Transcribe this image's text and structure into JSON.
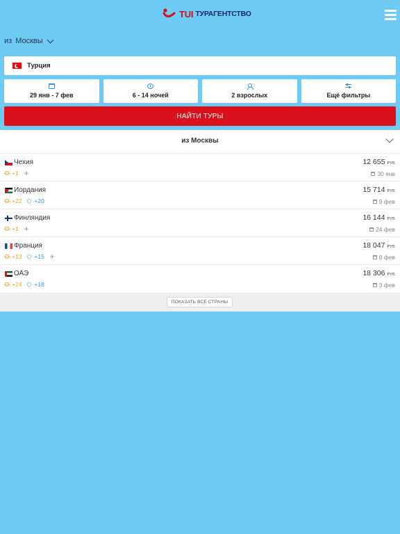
{
  "header": {
    "logo_brand": "TUI",
    "logo_text": "ТУРАГЕНТСТВО",
    "brand_color": "#d40e14",
    "menu_icon": "hamburger-menu-icon"
  },
  "search": {
    "from_prefix": "из",
    "from_city": "Москвы",
    "country": "Турция",
    "filters": [
      {
        "icon": "calendar-icon",
        "label": "29 янв - 7 фев"
      },
      {
        "icon": "clock-icon",
        "label": "6 - 14 ночей"
      },
      {
        "icon": "person-icon",
        "label": "2 взрослых"
      },
      {
        "icon": "sliders-icon",
        "label": "Ещё фильтры"
      }
    ],
    "submit_label": "НАЙТИ ТУРЫ",
    "submit_color": "#d9111d"
  },
  "offers": {
    "title": "из Москвы",
    "currency": "РУБ",
    "rows": [
      {
        "country": "Чехия",
        "air": "+1",
        "sea": "",
        "flight_icon": true,
        "price": "12 655",
        "date": "30 янв"
      },
      {
        "country": "Иордания",
        "air": "+22",
        "sea": "+20",
        "flight_icon": false,
        "price": "15 714",
        "date": "9 фев"
      },
      {
        "country": "Финляндия",
        "air": "+1",
        "sea": "",
        "flight_icon": true,
        "price": "16 144",
        "date": "24 фев"
      },
      {
        "country": "Франция",
        "air": "+13",
        "sea": "+15",
        "flight_icon": true,
        "price": "18 047",
        "date": "8 фев"
      },
      {
        "country": "ОАЭ",
        "air": "+24",
        "sea": "+18",
        "flight_icon": false,
        "price": "18 306",
        "date": "3 фев"
      }
    ],
    "show_all_label": "ПОКАЗАТЬ ВСЕ СТРАНЫ"
  }
}
